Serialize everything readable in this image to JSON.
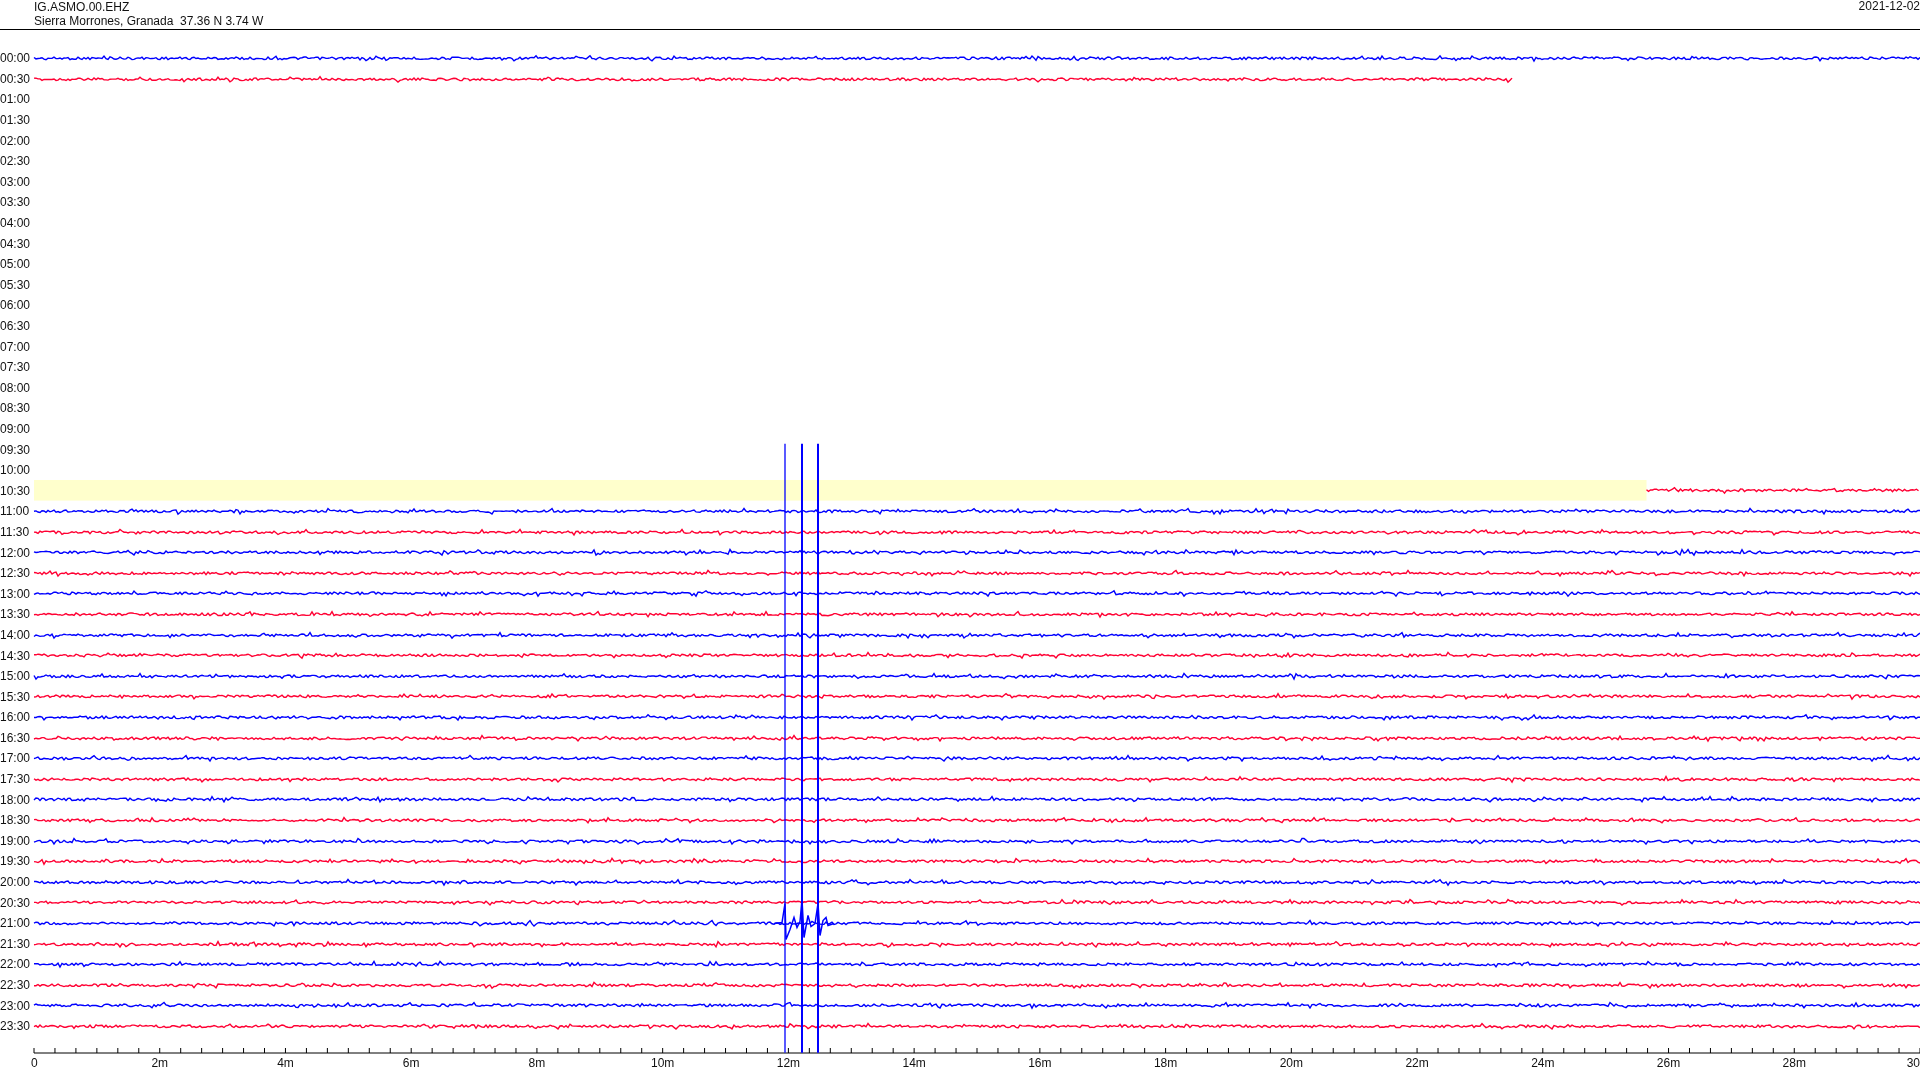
{
  "header": {
    "channel": "IG.ASMO.00.EHZ",
    "station": "Sierra Morrones, Granada  37.36 N 3.74 W",
    "date": "2021-12-02"
  },
  "rows": [
    {
      "time": "00:00",
      "kind": "full",
      "color": "#0000ff"
    },
    {
      "time": "00:30",
      "kind": "head",
      "color": "#ff0033",
      "level": 0.784
    },
    {
      "time": "01:00",
      "kind": "empty"
    },
    {
      "time": "01:30",
      "kind": "empty"
    },
    {
      "time": "02:00",
      "kind": "empty"
    },
    {
      "time": "02:30",
      "kind": "empty"
    },
    {
      "time": "03:00",
      "kind": "empty"
    },
    {
      "time": "03:30",
      "kind": "empty"
    },
    {
      "time": "04:00",
      "kind": "empty"
    },
    {
      "time": "04:30",
      "kind": "empty"
    },
    {
      "time": "05:00",
      "kind": "empty"
    },
    {
      "time": "05:30",
      "kind": "empty"
    },
    {
      "time": "06:00",
      "kind": "empty"
    },
    {
      "time": "06:30",
      "kind": "empty"
    },
    {
      "time": "07:00",
      "kind": "empty"
    },
    {
      "time": "07:30",
      "kind": "empty"
    },
    {
      "time": "08:00",
      "kind": "empty"
    },
    {
      "time": "08:30",
      "kind": "empty"
    },
    {
      "time": "09:00",
      "kind": "empty"
    },
    {
      "time": "09:30",
      "kind": "empty"
    },
    {
      "time": "10:00",
      "kind": "empty"
    },
    {
      "time": "10:30",
      "kind": "tail",
      "color": "#ff0033",
      "level": 0.145,
      "highlighted": true
    },
    {
      "time": "11:00",
      "kind": "full",
      "color": "#0000ff"
    },
    {
      "time": "11:30",
      "kind": "full",
      "color": "#ff0033"
    },
    {
      "time": "12:00",
      "kind": "full",
      "color": "#0000ff"
    },
    {
      "time": "12:30",
      "kind": "full",
      "color": "#ff0033"
    },
    {
      "time": "13:00",
      "kind": "full",
      "color": "#0000ff"
    },
    {
      "time": "13:30",
      "kind": "full",
      "color": "#ff0033"
    },
    {
      "time": "14:00",
      "kind": "full",
      "color": "#0000ff"
    },
    {
      "time": "14:30",
      "kind": "full",
      "color": "#ff0033"
    },
    {
      "time": "15:00",
      "kind": "full",
      "color": "#0000ff"
    },
    {
      "time": "15:30",
      "kind": "full",
      "color": "#ff0033"
    },
    {
      "time": "16:00",
      "kind": "full",
      "color": "#0000ff"
    },
    {
      "time": "16:30",
      "kind": "full",
      "color": "#ff0033"
    },
    {
      "time": "17:00",
      "kind": "full",
      "color": "#0000ff"
    },
    {
      "time": "17:30",
      "kind": "full",
      "color": "#ff0033"
    },
    {
      "time": "18:00",
      "kind": "full",
      "color": "#0000ff"
    },
    {
      "time": "18:30",
      "kind": "full",
      "color": "#ff0033"
    },
    {
      "time": "19:00",
      "kind": "full",
      "color": "#0000ff"
    },
    {
      "time": "19:30",
      "kind": "full",
      "color": "#ff0033"
    },
    {
      "time": "20:00",
      "kind": "full",
      "color": "#0000ff"
    },
    {
      "time": "20:30",
      "kind": "full",
      "color": "#ff0033"
    },
    {
      "time": "21:00",
      "kind": "full",
      "color": "#0000ff"
    },
    {
      "time": "21:30",
      "kind": "full",
      "color": "#ff0033"
    },
    {
      "time": "22:00",
      "kind": "full",
      "color": "#0000ff"
    },
    {
      "time": "22:30",
      "kind": "full",
      "color": "#ff0033"
    },
    {
      "time": "23:00",
      "kind": "full",
      "color": "#0000ff"
    },
    {
      "time": "23:30",
      "kind": "full",
      "color": "#ff0033"
    }
  ],
  "x_axis": {
    "labels": [
      "0",
      "2m",
      "4m",
      "6m",
      "8m",
      "10m",
      "12m",
      "14m",
      "16m",
      "18m",
      "20m",
      "22m",
      "24m",
      "26m",
      "28m",
      "30"
    ]
  }
}
